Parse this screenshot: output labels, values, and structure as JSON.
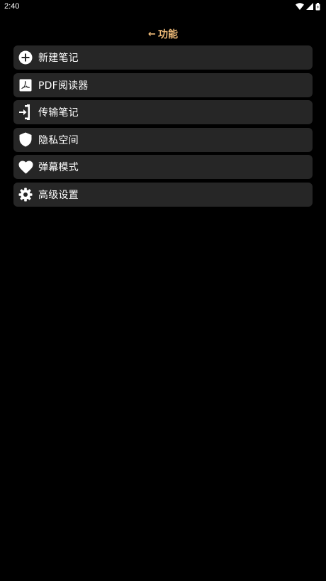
{
  "status_bar": {
    "time": "2:40",
    "icons": [
      "wifi-icon",
      "signal-icon",
      "battery-icon"
    ]
  },
  "header": {
    "back_icon": "arrow-left-icon",
    "title": "功能",
    "title_color": "#f2bd7a"
  },
  "menu": {
    "items": [
      {
        "label": "新建笔记",
        "icon": "plus-circle-icon"
      },
      {
        "label": "PDF阅读器",
        "icon": "pdf-icon"
      },
      {
        "label": "传输笔记",
        "icon": "transfer-icon"
      },
      {
        "label": "隐私空间",
        "icon": "shield-icon"
      },
      {
        "label": "弹幕模式",
        "icon": "heart-icon"
      },
      {
        "label": "高级设置",
        "icon": "gear-icon"
      }
    ],
    "item_background": "#262626"
  },
  "colors": {
    "background": "#000000",
    "accent": "#f2bd7a",
    "text": "#ffffff"
  }
}
